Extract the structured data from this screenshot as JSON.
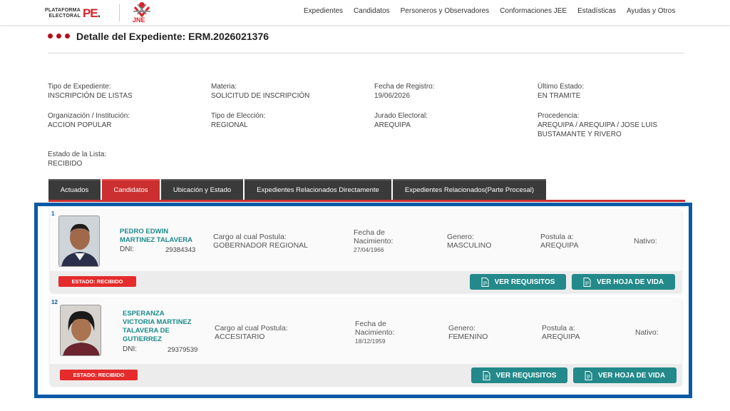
{
  "nav": {
    "brand_line1": "PLATAFORMA",
    "brand_line2": "ELECTORAL",
    "jne_label": "JNE",
    "items": [
      "Expedientes",
      "Candidatos",
      "Personeros y Observadores",
      "Conformaciones JEE",
      "Estadísticas",
      "Ayudas y Otros"
    ]
  },
  "title": "Detalle del Expediente: ERM.2026021376",
  "info": {
    "tipo_expediente": {
      "label": "Tipo de Expediente:",
      "value": "INSCRIPCIÓN DE LISTAS"
    },
    "materia": {
      "label": "Materia:",
      "value": "SOLICITUD DE INSCRIPCIÓN"
    },
    "fecha_registro": {
      "label": "Fecha de Registro:",
      "value": "19/06/2026"
    },
    "ultimo_estado": {
      "label": "Último Estado:",
      "value": "EN TRAMITE"
    },
    "organizacion": {
      "label": "Organización / Institución:",
      "value": "ACCION POPULAR"
    },
    "tipo_eleccion": {
      "label": "Tipo de Elección:",
      "value": "REGIONAL"
    },
    "jurado": {
      "label": "Jurado Electoral:",
      "value": "AREQUIPA"
    },
    "procedencia": {
      "label": "Procedencia:",
      "value": "AREQUIPA / AREQUIPA / JOSE LUIS BUSTAMANTE Y RIVERO"
    },
    "estado_lista": {
      "label": "Estado de la Lista:",
      "value": "RECIBIDO"
    }
  },
  "tabs": [
    "Actuados",
    "Candidatos",
    "Ubicación y Estado",
    "Expedientes Relacionados Directamente",
    "Expedientes Relacionados(Parte Procesal)"
  ],
  "labels": {
    "dni": "DNI:",
    "cargo": "Cargo al cual Postula:",
    "fecha_nac_1": "Fecha de",
    "fecha_nac_2": "Nacimiento:",
    "genero": "Genero:",
    "postula": "Postula a:",
    "nativo": "Nativo:",
    "ver_requisitos": "VER REQUISITOS",
    "ver_hoja": "VER HOJA DE VIDA"
  },
  "candidates": [
    {
      "num": "1",
      "name_lines": [
        "PEDRO EDWIN",
        "MARTINEZ TALAVERA"
      ],
      "dni": "29384343",
      "cargo": "GOBERNADOR REGIONAL",
      "fecha_nacimiento": "27/04/1966",
      "genero": "MASCULINO",
      "postula": "AREQUIPA",
      "estado": "ESTADO: RECIBIDO"
    },
    {
      "num": "12",
      "name_lines": [
        "ESPERANZA",
        "VICTORIA MARTINEZ",
        "TALAVERA DE",
        "GUTIERREZ"
      ],
      "dni": "29379539",
      "cargo": "ACCESITARIO",
      "fecha_nacimiento": "18/12/1959",
      "genero": "FEMENINO",
      "postula": "AREQUIPA",
      "estado": "ESTADO: RECIBIDO"
    }
  ],
  "colors": {
    "accent_red": "#cc2f2f",
    "teal": "#23898a",
    "highlight_blue": "#0b5aa5",
    "badge_red": "#e52b2b"
  }
}
